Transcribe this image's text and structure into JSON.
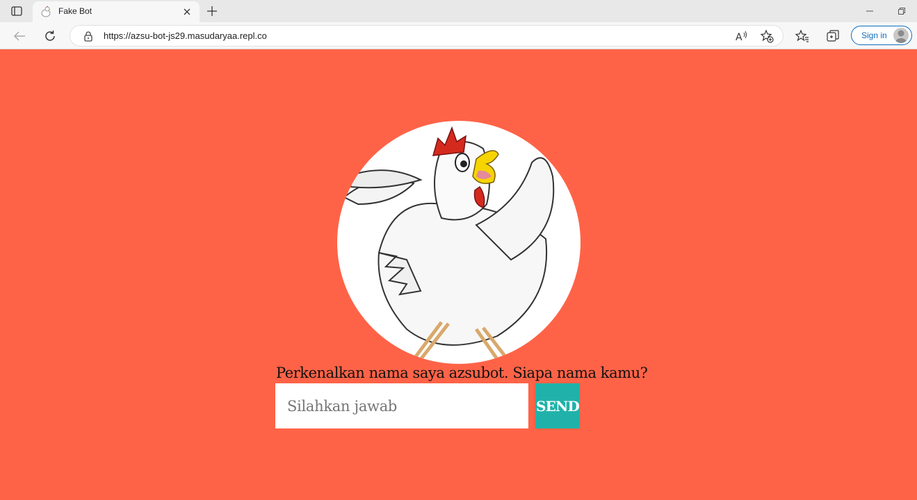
{
  "browser": {
    "tab": {
      "title": "Fake Bot",
      "favicon": "chicken-icon"
    },
    "address": {
      "url": "https://azsu-bot-js29.masudaryaa.repl.co"
    },
    "signin_label": "Sign in",
    "icons": [
      "sidebar-icon",
      "close-icon",
      "plus-icon",
      "minimize-icon",
      "restore-icon",
      "back-arrow-icon",
      "refresh-icon",
      "lock-icon",
      "read-aloud-icon",
      "add-favorite-icon",
      "favorites-icon",
      "collections-icon",
      "profile-icon"
    ]
  },
  "page": {
    "background_color": "#ff6347",
    "accent_color": "#20b2aa",
    "prompt": "Perkenalkan nama saya azsubot. Siapa nama kamu?",
    "answer_placeholder": "Silahkan jawab",
    "answer_value": "",
    "send_label": "SEND"
  }
}
